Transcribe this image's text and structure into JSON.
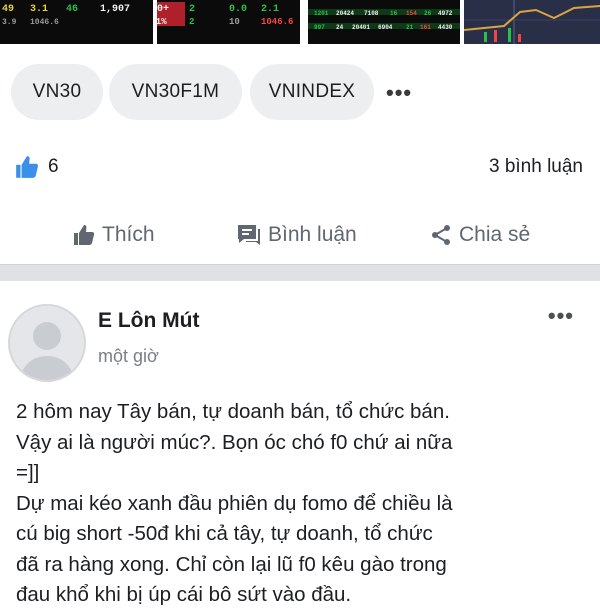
{
  "thumbnails": {
    "t1_row1": [
      "49",
      "3.1",
      "46",
      "1,907"
    ],
    "t1_row2": [
      "3.9",
      "1046.6"
    ],
    "t2_row1": [
      "200+",
      "2",
      "0.0",
      "2.1"
    ],
    "t2_row2": [
      "5.1%",
      "2",
      "10",
      "1046.6"
    ],
    "t3_row1": [
      "1201",
      "20424",
      "7108",
      "16",
      "154",
      "26",
      "4972"
    ],
    "t3_row2": [
      "997",
      "24",
      "20401",
      "6904",
      "21",
      "161",
      "4430"
    ]
  },
  "tags": [
    {
      "label": "VN30"
    },
    {
      "label": "VN30F1M"
    },
    {
      "label": "VNINDEX"
    }
  ],
  "tags_more": "•••",
  "stats": {
    "like_count": "6",
    "comment_count": "3 bình luận"
  },
  "actions": {
    "like": "Thích",
    "comment": "Bình luận",
    "share": "Chia sẻ"
  },
  "post": {
    "author": "E Lôn Mút",
    "time": "một giờ",
    "more": "•••",
    "text": "2 hôm nay Tây bán, tự doanh bán, tổ chức bán.\nVậy ai là người múc?. Bọn óc chó f0 chứ ai nữa\n=]]\nDự mai kéo xanh đầu phiên dụ fomo để chiều là\ncú big short -50đ khi cả tây, tự doanh, tổ chức\nđã ra hàng xong. Chỉ còn lại lũ f0 kêu gào trong\nđau khổ khi bị úp cái bô sứt vào đầu."
  },
  "colors": {
    "accent_blue": "#1877f2",
    "action_gray": "#606770",
    "chip_bg": "#eceef0",
    "divider": "#dfe1e5"
  }
}
